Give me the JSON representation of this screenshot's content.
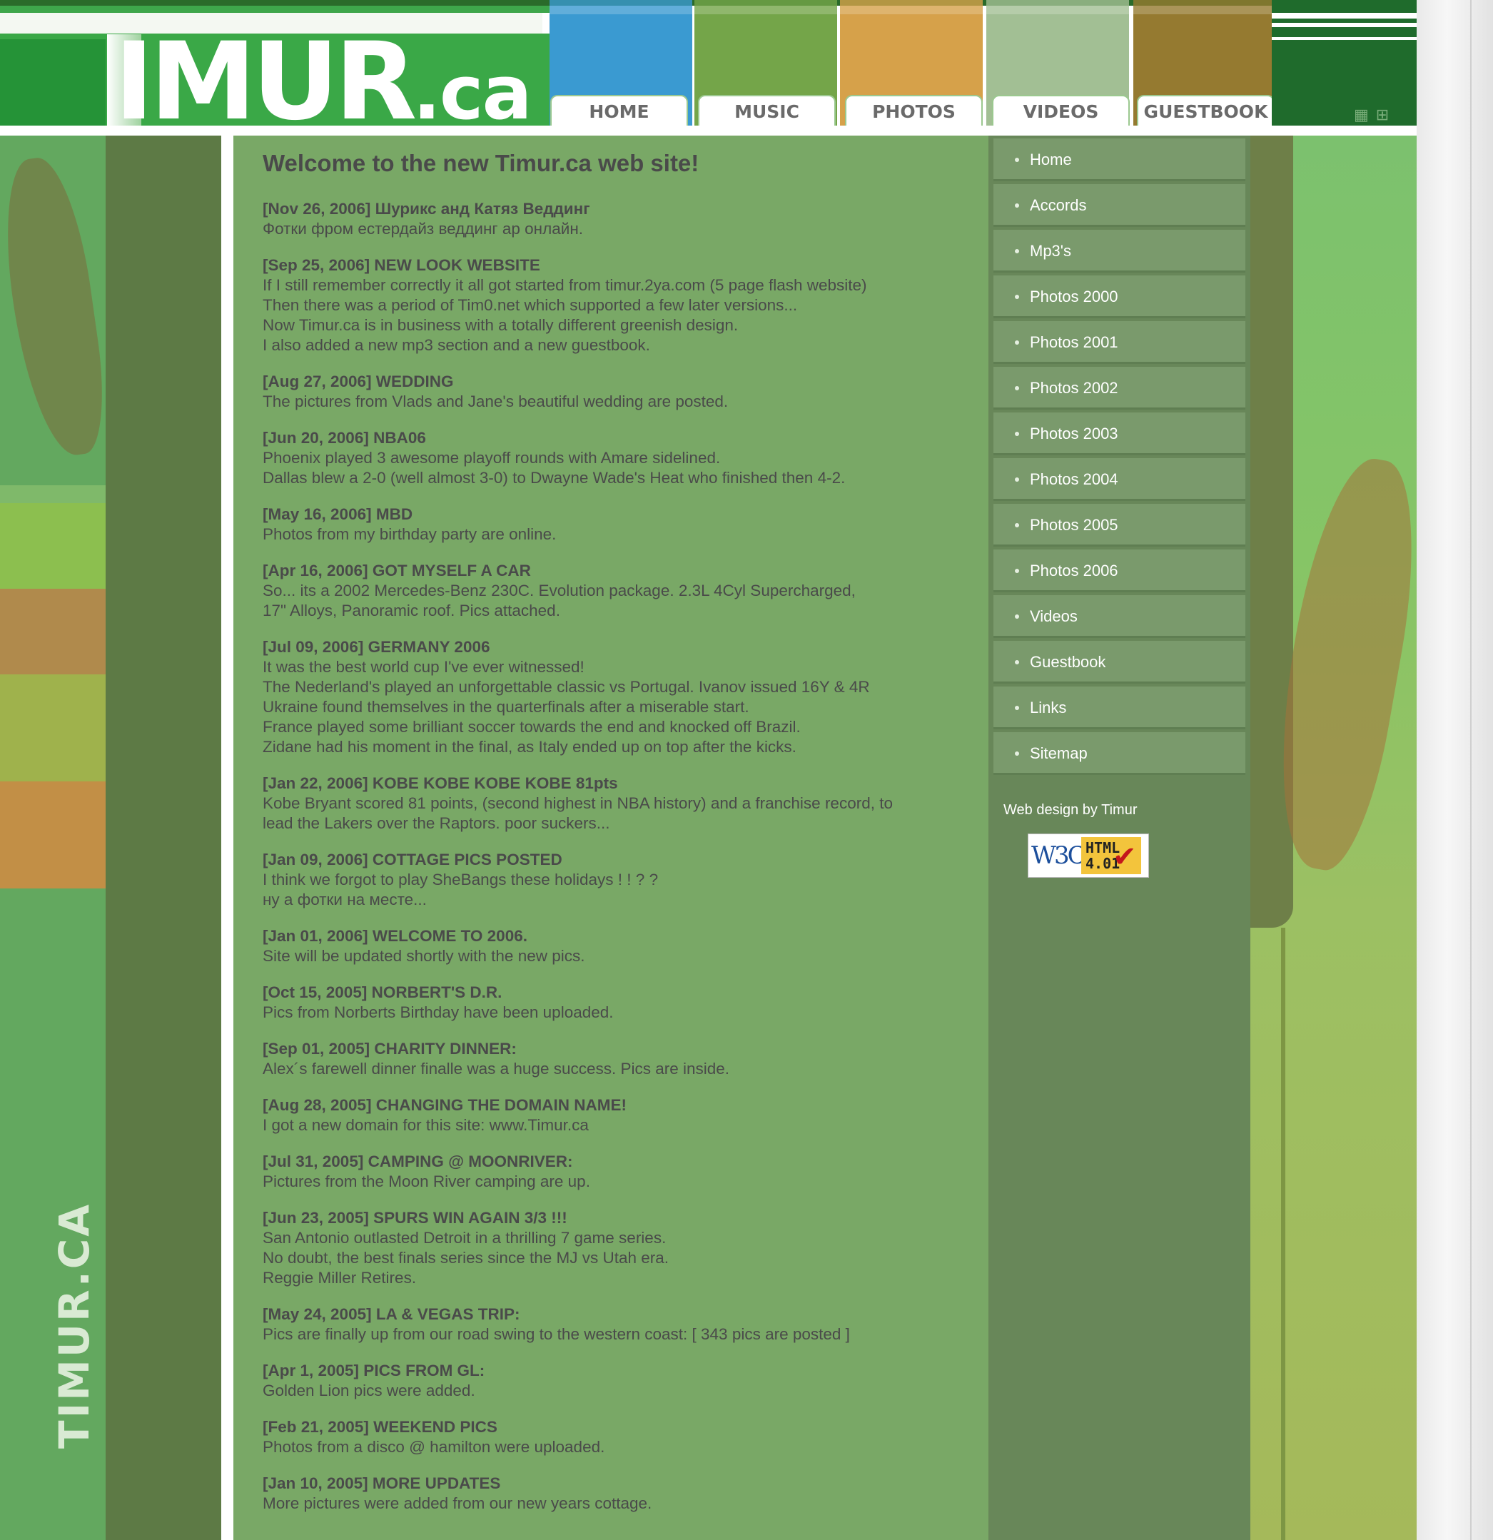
{
  "site": {
    "logo_main": "IMUR",
    "logo_suffix": ".ca",
    "vertical_logo": "TIMUR.CA"
  },
  "nav_tabs": [
    {
      "label": "HOME",
      "color": "#3a9ad1"
    },
    {
      "label": "MUSIC",
      "color": "#74a549"
    },
    {
      "label": "PHOTOS",
      "color": "#d6a14a"
    },
    {
      "label": "VIDEOS",
      "color": "#a2bf94"
    },
    {
      "label": "GUESTBOOK",
      "color": "#957a30"
    }
  ],
  "main": {
    "welcome": "Welcome to the new Timur.ca web site!",
    "news": [
      {
        "title": "[Nov 26, 2006] Шурикс анд Катяз Веддинг",
        "lines": [
          "Фотки фром естердайз веддинг ар онлайн."
        ]
      },
      {
        "title": "[Sep 25, 2006] NEW LOOK WEBSITE",
        "lines": [
          "If I still remember correctly it all got started from timur.2ya.com (5 page flash website)",
          "Then there was a period of Tim0.net which supported a few later versions...",
          "Now Timur.ca is in business with a totally different greenish design.",
          "I also added a new mp3 section and a new guestbook."
        ]
      },
      {
        "title": "[Aug 27, 2006] WEDDING",
        "lines": [
          "The pictures from Vlads and Jane's beautiful wedding are posted."
        ]
      },
      {
        "title": "[Jun 20, 2006] NBA06",
        "lines": [
          "Phoenix played 3 awesome playoff rounds with Amare sidelined.",
          "Dallas blew a 2-0 (well almost 3-0) to Dwayne Wade's Heat who finished then 4-2."
        ]
      },
      {
        "title": "[May 16, 2006] MBD",
        "lines": [
          "Photos from my birthday party are online."
        ]
      },
      {
        "title": "[Apr 16, 2006] GOT MYSELF A CAR",
        "lines": [
          "So... its a 2002 Mercedes-Benz 230C. Evolution package. 2.3L 4Cyl Supercharged,",
          "17\" Alloys, Panoramic roof. Pics attached."
        ]
      },
      {
        "title": "[Jul 09, 2006] GERMANY 2006",
        "lines": [
          "It was the best world cup I've ever witnessed!",
          "The Nederland's played an unforgettable classic vs Portugal. Ivanov issued 16Y & 4R",
          "Ukraine found themselves in the quarterfinals after a miserable start.",
          "France played some brilliant soccer towards the end and knocked off Brazil.",
          "Zidane had his moment in the final, as Italy ended up on top after the kicks."
        ]
      },
      {
        "title": "[Jan 22, 2006] KOBE KOBE KOBE KOBE 81pts",
        "lines": [
          "Kobe Bryant scored 81 points, (second highest in NBA history) and a franchise record, to",
          "lead the Lakers over the Raptors. poor suckers..."
        ]
      },
      {
        "title": "[Jan 09, 2006] COTTAGE PICS POSTED",
        "lines": [
          "I think we forgot to play SheBangs these holidays ! ! ? ?",
          "ну а фотки на месте..."
        ]
      },
      {
        "title": "[Jan 01, 2006] WELCOME TO 2006.",
        "lines": [
          "Site will be updated shortly with the new pics."
        ]
      },
      {
        "title": "[Oct 15, 2005] NORBERT'S D.R.",
        "lines": [
          "Pics from Norberts Birthday have been uploaded."
        ]
      },
      {
        "title": "[Sep 01, 2005] CHARITY DINNER:",
        "lines": [
          "Alex´s farewell dinner finalle was a huge success. Pics are inside."
        ]
      },
      {
        "title": "[Aug 28, 2005] CHANGING THE DOMAIN NAME!",
        "lines": [
          "I got a new domain for this site: www.Timur.ca"
        ]
      },
      {
        "title": "[Jul 31, 2005] CAMPING @ MOONRIVER:",
        "lines": [
          "Pictures from the Moon River camping are up."
        ]
      },
      {
        "title": "[Jun 23, 2005] SPURS WIN AGAIN 3/3 !!!",
        "lines": [
          "San Antonio outlasted Detroit in a thrilling 7 game series.",
          "No doubt, the best finals series since the MJ vs Utah era.",
          "Reggie Miller Retires."
        ]
      },
      {
        "title": "[May 24, 2005] LA & VEGAS TRIP:",
        "lines": [
          "Pics are finally up from our road swing to the western coast: [ 343 pics are posted ]"
        ]
      },
      {
        "title": "[Apr 1, 2005] PICS FROM GL:",
        "lines": [
          "Golden Lion pics were added."
        ]
      },
      {
        "title": "[Feb 21, 2005] WEEKEND PICS",
        "lines": [
          "Photos from a disco @ hamilton were uploaded."
        ]
      },
      {
        "title": "[Jan 10, 2005] MORE UPDATES",
        "lines": [
          "More pictures were added from our new years cottage."
        ]
      }
    ]
  },
  "sidebar": {
    "items": [
      "Home",
      "Accords",
      "Mp3's",
      "Photos 2000",
      "Photos 2001",
      "Photos 2002",
      "Photos 2003",
      "Photos 2004",
      "Photos 2005",
      "Photos 2006",
      "Videos",
      "Guestbook",
      "Links",
      "Sitemap"
    ],
    "credit": "Web design by Timur",
    "badge": {
      "left": "W3C",
      "right_line1": "HTML",
      "right_line2": "4.01"
    }
  },
  "header_icons": [
    "grid-view-icon",
    "sitemap-icon"
  ],
  "colors": {
    "content_bg": "#79a866",
    "sidebar_bg": "#688759",
    "menu_item_bg": "#7a9a6c",
    "text": "#4a4a4a",
    "logo_green": "#3aa847"
  }
}
